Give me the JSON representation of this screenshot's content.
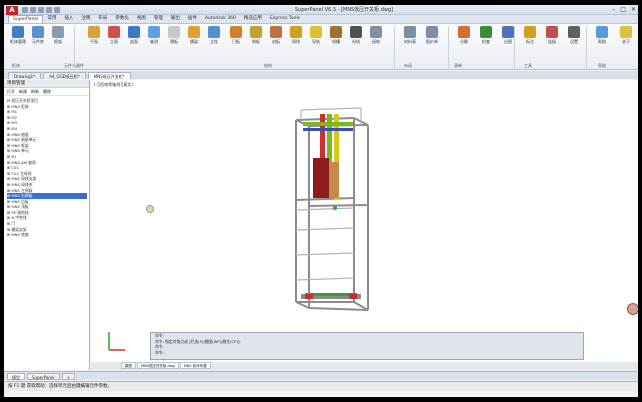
{
  "window": {
    "logo": "A",
    "title": "SuperPanel V6.3 - [MNS低压开关柜.dwg]",
    "controls": [
      "–",
      "□",
      "✕"
    ]
  },
  "menu_tabs": [
    "SuperPanel",
    "常用",
    "插入",
    "注释",
    "布局",
    "参数化",
    "视图",
    "管理",
    "输出",
    "插件",
    "Autodesk 360",
    "精选应用",
    "Express Tools"
  ],
  "ribbon": {
    "buttons": [
      {
        "label": "柜体管理",
        "color": "#3f7fc8"
      },
      {
        "label": "元件库",
        "color": "#5a8fd2"
      },
      {
        "label": "框架",
        "color": "#8a9bb0"
      },
      {
        "label": "平面",
        "color": "#d8a240"
      },
      {
        "label": "立面",
        "color": "#d05050"
      },
      {
        "label": "剖面",
        "color": "#3a7ac8"
      },
      {
        "label": "轴测",
        "color": "#60a0e0"
      },
      {
        "label": "隔板",
        "color": "#c8c8c8"
      },
      {
        "label": "横梁",
        "color": "#e0a030"
      },
      {
        "label": "立柱",
        "color": "#5090d0"
      },
      {
        "label": "门板",
        "color": "#d08030"
      },
      {
        "label": "侧板",
        "color": "#c0a030"
      },
      {
        "label": "封板",
        "color": "#c07040"
      },
      {
        "label": "铜排",
        "color": "#d0a020"
      },
      {
        "label": "导轨",
        "color": "#e0c030"
      },
      {
        "label": "线槽",
        "color": "#a07030"
      },
      {
        "label": "母线",
        "color": "#505050"
      },
      {
        "label": "接地",
        "color": "#8090a0"
      },
      {
        "label": "材料表",
        "color": "#7a8ea6"
      },
      {
        "label": "报价单",
        "color": "#7a8ea6"
      },
      {
        "label": "分解",
        "color": "#d07030"
      },
      {
        "label": "检查",
        "color": "#3a8a3a"
      },
      {
        "label": "出图",
        "color": "#5070c0"
      },
      {
        "label": "标注",
        "color": "#d0a020"
      },
      {
        "label": "连接",
        "color": "#c05050"
      },
      {
        "label": "设置",
        "color": "#606060"
      },
      {
        "label": "帮助",
        "color": "#5a9ad8"
      },
      {
        "label": "关于",
        "color": "#e0c040"
      }
    ],
    "groups": [
      "柜体",
      "元件与器件",
      "结构",
      "布局",
      "清单",
      "工具",
      "帮助"
    ]
  },
  "doc_tabs": [
    {
      "label": "Drawing1*",
      "active": false
    },
    {
      "label": "A4_GGD低压柜*",
      "active": false
    },
    {
      "label": "MNS低压开关柜*",
      "active": true
    }
  ],
  "left_panel": {
    "title": "项目管理",
    "tools": [
      "打开",
      "新建",
      "刷新",
      "删除"
    ],
    "tree": [
      "⊟ 低压开关柜项目",
      " ⊞ MNS 柜体",
      " ⊞ M1",
      " ⊞ M2",
      " ⊞ M3",
      " ⊞ M4",
      " ⊞ MNS 抽屉",
      " ⊞ MNS 抽屉单元",
      " ⊞ MNS 框架",
      " ⊞ MNS 单元",
      " ⊞ B1",
      " ⊞ MNS-AM 抽屉",
      " ⊞ C01",
      " ⊞ C02 主母线",
      " ⊞ MNS 母线支架",
      " ⊞ MNS 母线夹",
      " ⊞ MNS 左侧板",
      " ⊞ MNS 右侧板",
      " ⊞ MNS 后板",
      " ⊞ MNS 顶板",
      " ⊞ PE 接地排",
      " ⊞ N 中性排",
      " ⊞ 门",
      " ⊞ 横梁支架",
      " ⊞ MNS 底座"
    ],
    "selected_index": 17
  },
  "viewport": {
    "label": "[-][西南等轴测][真实]"
  },
  "command_line": [
    "命令:",
    "命令: 指定对角点或 [栏选(F)/圈围(WP)/圈交(CP)]:",
    "命令:",
    "命令:"
  ],
  "layout_tabs": [
    {
      "label": "模型",
      "active": false
    },
    {
      "label": "MNS低压开关柜.dwg",
      "active": false
    },
    {
      "label": "MNS 柜体布置",
      "active": true
    }
  ],
  "panel_tabs": [
    {
      "label": "模型",
      "active": true
    },
    {
      "label": "SuperPanel",
      "active": false
    },
    {
      "label": "+",
      "active": false
    }
  ],
  "status_text": "按 F1 键 获取帮助 · 选择单元后右键编辑元件参数。"
}
